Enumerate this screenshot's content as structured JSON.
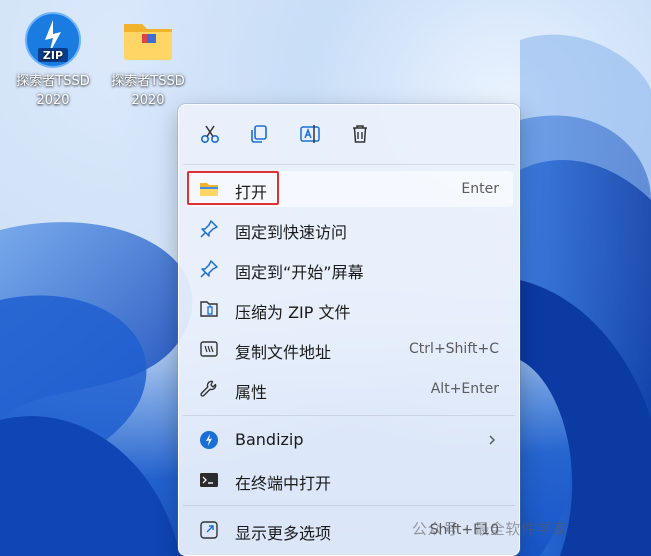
{
  "desktop": {
    "icons": [
      {
        "line1": "探索者TSSD",
        "line2": "2020",
        "icon": "zip-archive-icon"
      },
      {
        "line1": "探索者TSSD",
        "line2": "2020",
        "icon": "folder-icon"
      }
    ]
  },
  "context_menu": {
    "toolbar": [
      {
        "name": "cut",
        "icon": "scissors-icon"
      },
      {
        "name": "copy",
        "icon": "copy-icon"
      },
      {
        "name": "rename",
        "icon": "rename-icon"
      },
      {
        "name": "delete",
        "icon": "trash-icon"
      }
    ],
    "items": [
      {
        "label": "打开",
        "shortcut": "Enter",
        "icon": "folder-open-icon"
      },
      {
        "label": "固定到快速访问",
        "shortcut": "",
        "icon": "pin-icon"
      },
      {
        "label": "固定到“开始”屏幕",
        "shortcut": "",
        "icon": "pin-icon"
      },
      {
        "label": "压缩为 ZIP 文件",
        "shortcut": "",
        "icon": "zip-file-icon"
      },
      {
        "label": "复制文件地址",
        "shortcut": "Ctrl+Shift+C",
        "icon": "copy-path-icon"
      },
      {
        "label": "属性",
        "shortcut": "Alt+Enter",
        "icon": "wrench-icon"
      },
      {
        "label": "Bandizip",
        "shortcut": "",
        "icon": "bandizip-icon"
      },
      {
        "label": "在终端中打开",
        "shortcut": "",
        "icon": "terminal-icon"
      },
      {
        "label": "显示更多选项",
        "shortcut": "Shift+F10",
        "icon": "more-options-icon"
      }
    ]
  },
  "watermark": "公众号 · 最全软件学家",
  "colors": {
    "highlight_border": "#e03131",
    "accent": "#1a6fd6"
  }
}
